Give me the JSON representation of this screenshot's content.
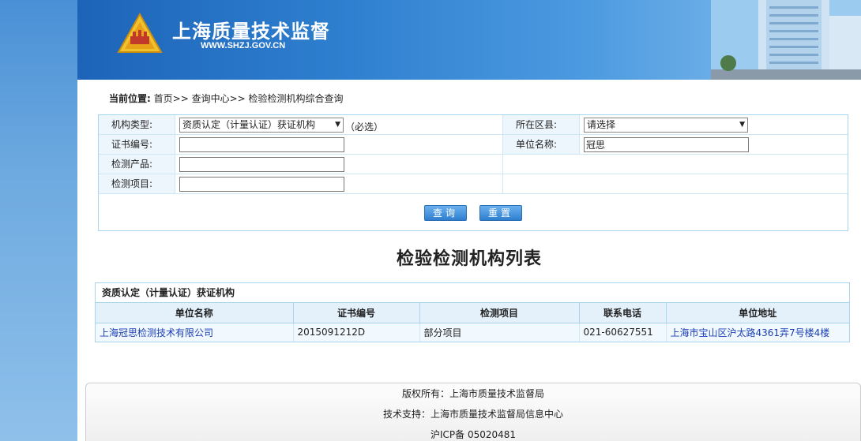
{
  "header": {
    "site_title": "上海质量技术监督",
    "site_url": "WWW.SHZJ.GOV.CN"
  },
  "breadcrumb": {
    "prefix": "当前位置:",
    "path": "首页>> 查询中心>> 检验检测机构综合查询"
  },
  "query": {
    "org_type_label": "机构类型:",
    "org_type_value": "资质认定（计量认证）获证机构",
    "required_note": "（必选）",
    "district_label": "所在区县:",
    "district_value": "请选择",
    "cert_no_label": "证书编号:",
    "cert_no_value": "",
    "unit_name_label": "单位名称:",
    "unit_name_value": "冠思",
    "product_label": "检测产品:",
    "product_value": "",
    "item_label": "检测项目:",
    "item_value": "",
    "search_button": "查询",
    "reset_button": "重置"
  },
  "list": {
    "title": "检验检测机构列表",
    "caption": "资质认定（计量认证）获证机构",
    "columns": [
      "单位名称",
      "证书编号",
      "检测项目",
      "联系电话",
      "单位地址"
    ],
    "rows": [
      {
        "name": "上海冠思检测技术有限公司",
        "cert_no": "2015091212D",
        "items": "部分项目",
        "phone": "021-60627551",
        "address": "上海市宝山区沪太路4361弄7号楼4楼"
      }
    ]
  },
  "footer": {
    "copyright": "版权所有：上海市质量技术监督局",
    "support": "技术支持：上海市质量技术监督局信息中心",
    "icp": "沪ICP备 05020481"
  },
  "colors": {
    "banner_blue": "#2f80d0",
    "link": "#1a3fb5",
    "button": "#2f7fcf"
  }
}
